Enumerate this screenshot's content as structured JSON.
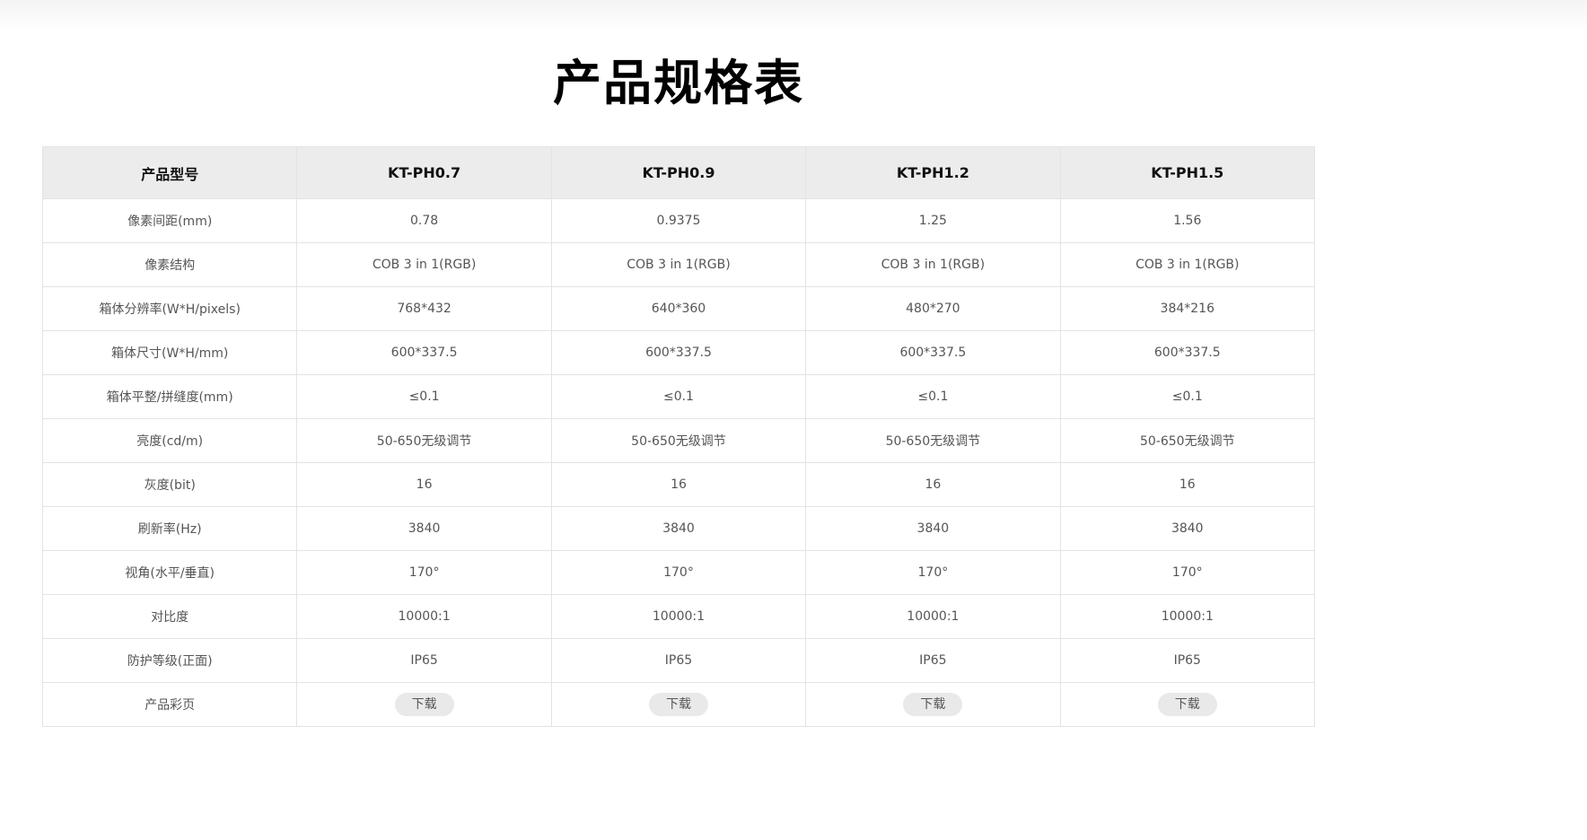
{
  "title": "产品规格表",
  "table": {
    "headers": [
      "产品型号",
      "KT-PH0.7",
      "KT-PH0.9",
      "KT-PH1.2",
      "KT-PH1.5"
    ],
    "rows": [
      [
        "像素间距(mm)",
        "0.78",
        "0.9375",
        "1.25",
        "1.56"
      ],
      [
        "像素结构",
        "COB 3 in 1(RGB)",
        "COB 3 in 1(RGB)",
        "COB 3 in 1(RGB)",
        "COB 3 in 1(RGB)"
      ],
      [
        "箱体分辨率(W*H/pixels)",
        "768*432",
        "640*360",
        "480*270",
        "384*216"
      ],
      [
        "箱体尺寸(W*H/mm)",
        "600*337.5",
        "600*337.5",
        "600*337.5",
        "600*337.5"
      ],
      [
        "箱体平整/拼缝度(mm)",
        "≤0.1",
        "≤0.1",
        "≤0.1",
        "≤0.1"
      ],
      [
        "亮度(cd/m)",
        "50-650无级调节",
        "50-650无级调节",
        "50-650无级调节",
        "50-650无级调节"
      ],
      [
        "灰度(bit)",
        "16",
        "16",
        "16",
        "16"
      ],
      [
        "刷新率(Hz)",
        "3840",
        "3840",
        "3840",
        "3840"
      ],
      [
        "视角(水平/垂直)",
        "170°",
        "170°",
        "170°",
        "170°"
      ],
      [
        "对比度",
        "10000:1",
        "10000:1",
        "10000:1",
        "10000:1"
      ],
      [
        "防护等级(正面)",
        "IP65",
        "IP65",
        "IP65",
        "IP65"
      ]
    ],
    "brochure_label": "产品彩页",
    "download_label": "下载"
  },
  "colors": {
    "header_bg": "#ececec",
    "border": "#e3e3e3",
    "button_bg": "#e9e9e9"
  }
}
